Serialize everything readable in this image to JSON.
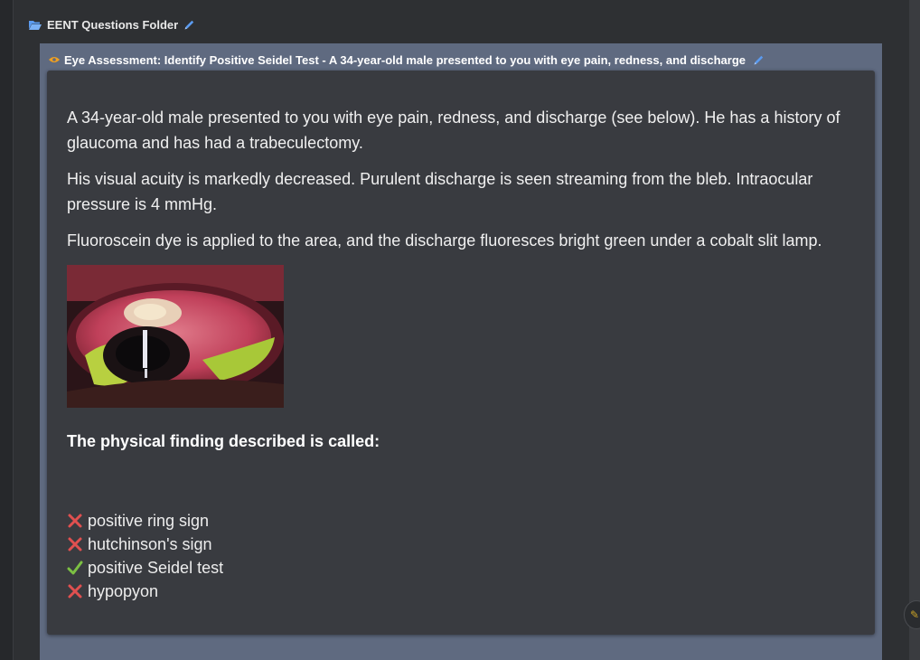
{
  "folder": {
    "title": "EENT Questions Folder",
    "icon": "folder-open-icon"
  },
  "item": {
    "title": "Eye Assessment: Identify Positive Seidel Test - A 34-year-old male presented to you with eye pain, redness, and discharge",
    "icon": "eye-icon"
  },
  "question": {
    "paragraphs": [
      "A 34-year-old male presented to you with eye pain, redness, and discharge (see below). He has a history of glaucoma and has had a trabeculectomy.",
      "His visual acuity is markedly decreased. Purulent discharge is seen streaming from the bleb. Intraocular pressure is 4 mmHg.",
      "Fluoroscein dye is applied to the area, and the discharge fluoresces bright green under a cobalt slit lamp."
    ],
    "prompt": "The physical finding described is called:"
  },
  "answers": [
    {
      "label": "positive ring sign",
      "correct": false
    },
    {
      "label": "hutchinson's sign",
      "correct": false
    },
    {
      "label": "positive Seidel test",
      "correct": true
    },
    {
      "label": "hypopyon",
      "correct": false
    }
  ],
  "colors": {
    "background": "#2e3033",
    "panel": "#5f6a80",
    "card": "#393b40",
    "accent_blue": "#5b9bf0",
    "eye_orange": "#f0a020",
    "wrong_red": "#e05050",
    "right_green": "#7cc043"
  }
}
